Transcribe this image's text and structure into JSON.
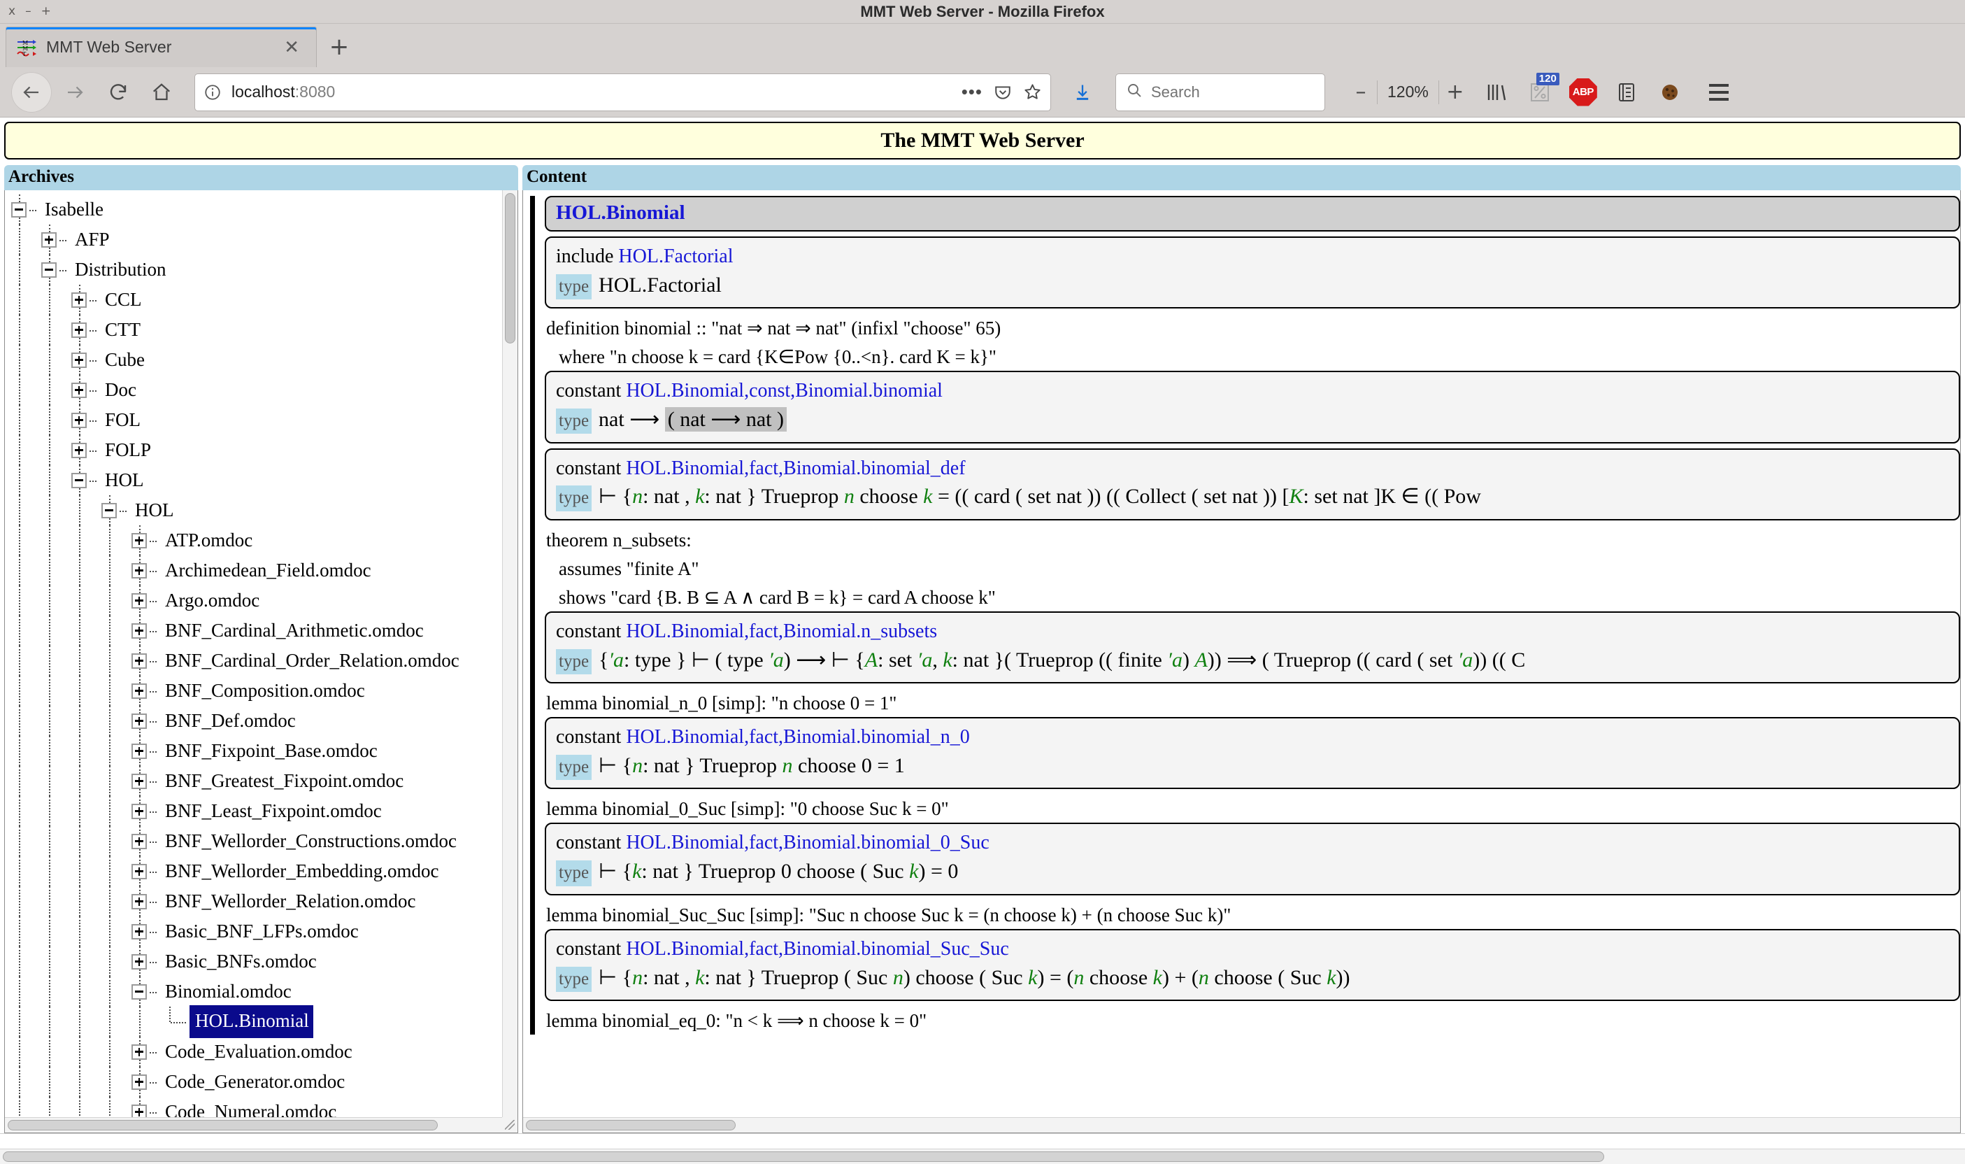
{
  "window": {
    "title": "MMT Web Server - Mozilla Firefox",
    "buttons": {
      "close": "x",
      "minimize": "–",
      "maximize": "+"
    }
  },
  "tab": {
    "title": "MMT Web Server",
    "close_label": "✕",
    "new_tab_label": "+"
  },
  "toolbar": {
    "back_icon": "back-arrow-icon",
    "forward_icon": "forward-arrow-icon",
    "reload_icon": "reload-icon",
    "home_icon": "home-icon",
    "url": "localhost",
    "url_port": ":8080",
    "page_actions_label": "•••",
    "pocket_icon": "pocket-icon",
    "bookmark_icon": "star-icon",
    "download_icon": "download-icon",
    "search_placeholder": "Search",
    "zoom_out_label": "–",
    "zoom_level": "120%",
    "zoom_in_label": "+",
    "library_icon": "library-icon",
    "zoom_badge": "120",
    "adblock_label": "ABP",
    "reader_icon": "reader-view-icon",
    "cookie_icon": "cookie-icon",
    "menu_icon": "hamburger-menu-icon"
  },
  "page": {
    "banner_title": "The MMT Web Server",
    "archives_header": "Archives",
    "content_header": "Content"
  },
  "tree": [
    {
      "label": "Isabelle",
      "depth": 0,
      "state": "minus"
    },
    {
      "label": "AFP",
      "depth": 1,
      "state": "plus"
    },
    {
      "label": "Distribution",
      "depth": 1,
      "state": "minus"
    },
    {
      "label": "CCL",
      "depth": 2,
      "state": "plus"
    },
    {
      "label": "CTT",
      "depth": 2,
      "state": "plus"
    },
    {
      "label": "Cube",
      "depth": 2,
      "state": "plus"
    },
    {
      "label": "Doc",
      "depth": 2,
      "state": "plus"
    },
    {
      "label": "FOL",
      "depth": 2,
      "state": "plus"
    },
    {
      "label": "FOLP",
      "depth": 2,
      "state": "plus"
    },
    {
      "label": "HOL",
      "depth": 2,
      "state": "minus"
    },
    {
      "label": "HOL",
      "depth": 3,
      "state": "minus"
    },
    {
      "label": "ATP.omdoc",
      "depth": 4,
      "state": "plus"
    },
    {
      "label": "Archimedean_Field.omdoc",
      "depth": 4,
      "state": "plus"
    },
    {
      "label": "Argo.omdoc",
      "depth": 4,
      "state": "plus"
    },
    {
      "label": "BNF_Cardinal_Arithmetic.omdoc",
      "depth": 4,
      "state": "plus"
    },
    {
      "label": "BNF_Cardinal_Order_Relation.omdoc",
      "depth": 4,
      "state": "plus"
    },
    {
      "label": "BNF_Composition.omdoc",
      "depth": 4,
      "state": "plus"
    },
    {
      "label": "BNF_Def.omdoc",
      "depth": 4,
      "state": "plus"
    },
    {
      "label": "BNF_Fixpoint_Base.omdoc",
      "depth": 4,
      "state": "plus"
    },
    {
      "label": "BNF_Greatest_Fixpoint.omdoc",
      "depth": 4,
      "state": "plus"
    },
    {
      "label": "BNF_Least_Fixpoint.omdoc",
      "depth": 4,
      "state": "plus"
    },
    {
      "label": "BNF_Wellorder_Constructions.omdoc",
      "depth": 4,
      "state": "plus"
    },
    {
      "label": "BNF_Wellorder_Embedding.omdoc",
      "depth": 4,
      "state": "plus"
    },
    {
      "label": "BNF_Wellorder_Relation.omdoc",
      "depth": 4,
      "state": "plus"
    },
    {
      "label": "Basic_BNF_LFPs.omdoc",
      "depth": 4,
      "state": "plus"
    },
    {
      "label": "Basic_BNFs.omdoc",
      "depth": 4,
      "state": "plus"
    },
    {
      "label": "Binomial.omdoc",
      "depth": 4,
      "state": "minus"
    },
    {
      "label": "HOL.Binomial",
      "depth": 5,
      "state": "leaf",
      "selected": true
    },
    {
      "label": "Code_Evaluation.omdoc",
      "depth": 4,
      "state": "plus"
    },
    {
      "label": "Code_Generator.omdoc",
      "depth": 4,
      "state": "plus"
    },
    {
      "label": "Code_Numeral.omdoc",
      "depth": 4,
      "state": "plus"
    }
  ],
  "content": {
    "theory_name": "HOL.Binomial",
    "include_block": {
      "keyword": "include",
      "target": "HOL.Factorial",
      "type_badge": "type",
      "type_value": "HOL.Factorial"
    },
    "sections": [
      {
        "source": [
          "definition binomial :: \"nat ⇒ nat ⇒ nat\"  (infixl \"choose\" 65)",
          "where \"n choose k = card {K∈Pow {0..<n}. card K = k}\""
        ],
        "constant_keyword": "constant",
        "constant_name": "HOL.Binomial,const,Binomial.binomial",
        "type_badge": "type",
        "type_expr": "nat ⟶ ( nat ⟶ nat )"
      },
      {
        "source": [],
        "constant_keyword": "constant",
        "constant_name": "HOL.Binomial,fact,Binomial.binomial_def",
        "type_badge": "type",
        "type_expr": "⊢ {n: nat , k: nat } Trueprop n choose k = (( card ( set  nat )) (( Collect ( set  nat )) [K: set  nat ]K ∈ (( Pow"
      },
      {
        "source": [
          "theorem n_subsets:",
          "assumes \"finite A\"",
          "shows \"card {B. B ⊆ A ∧ card B = k} = card A choose k\""
        ],
        "constant_keyword": "constant",
        "constant_name": "HOL.Binomial,fact,Binomial.n_subsets",
        "type_badge": "type",
        "type_expr": "{'a: type } ⊢ ( type 'a) ⟶ ⊢ {A: set 'a, k: nat }( Trueprop (( finite 'a) A)) ⟹ ( Trueprop (( card ( set 'a)) (( C"
      },
      {
        "source": [
          "lemma binomial_n_0 [simp]: \"n choose 0 = 1\""
        ],
        "constant_keyword": "constant",
        "constant_name": "HOL.Binomial,fact,Binomial.binomial_n_0",
        "type_badge": "type",
        "type_expr": "⊢ {n: nat } Trueprop n choose  0  =  1"
      },
      {
        "source": [
          "lemma binomial_0_Suc [simp]: \"0 choose Suc k = 0\""
        ],
        "constant_keyword": "constant",
        "constant_name": "HOL.Binomial,fact,Binomial.binomial_0_Suc",
        "type_badge": "type",
        "type_expr": "⊢ {k: nat } Trueprop  0  choose ( Suc k) =  0"
      },
      {
        "source": [
          "lemma binomial_Suc_Suc [simp]: \"Suc n choose Suc k = (n choose k) + (n choose Suc k)\""
        ],
        "constant_keyword": "constant",
        "constant_name": "HOL.Binomial,fact,Binomial.binomial_Suc_Suc",
        "type_badge": "type",
        "type_expr": "⊢ {n: nat , k: nat } Trueprop ( Suc n) choose ( Suc k) = (n choose k) + (n choose ( Suc k))"
      },
      {
        "source": [
          "lemma binomial_eq_0: \"n < k ⟹ n choose k = 0\""
        ],
        "constant_keyword": "",
        "constant_name": "",
        "type_badge": "",
        "type_expr": ""
      }
    ]
  }
}
